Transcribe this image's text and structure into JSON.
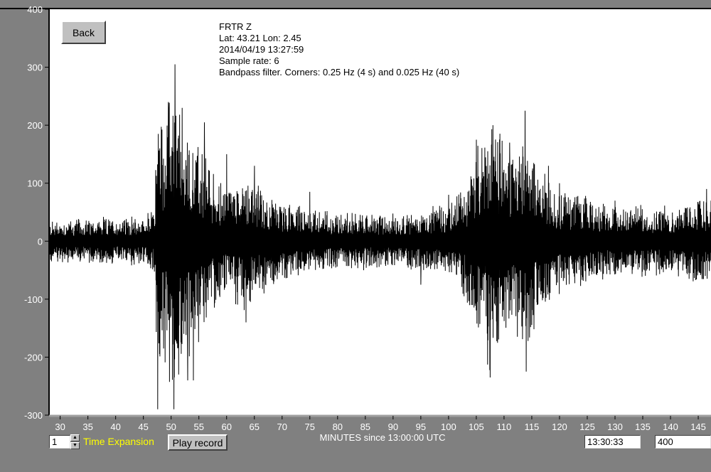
{
  "buttons": {
    "back": "Back",
    "play": "Play record"
  },
  "info": {
    "station": "FRTR  Z",
    "location": "Lat: 43.21 Lon: 2.45",
    "datetime": "2014/04/19 13:27:59",
    "sample_rate": "Sample rate: 6",
    "filter": "Bandpass filter. Corners: 0.25 Hz (4 s) and 0.025 Hz (40 s)"
  },
  "controls": {
    "expansion_value": "1",
    "expansion_label": "Time Expansion",
    "time_value": "13:30:33",
    "zoom_value": "400"
  },
  "chart_data": {
    "type": "line",
    "xlabel": "MINUTES since 13:00:00 UTC",
    "ylabel": "",
    "xlim": [
      28,
      147.3
    ],
    "ylim": [
      -300,
      400
    ],
    "x_ticks": [
      30,
      35,
      40,
      45,
      50,
      55,
      60,
      65,
      70,
      75,
      80,
      85,
      90,
      95,
      100,
      105,
      110,
      115,
      120,
      125,
      130,
      135,
      140,
      145
    ],
    "y_ticks": [
      -300,
      -200,
      -100,
      0,
      100,
      200,
      300,
      400
    ],
    "y_tick_labels": [
      "-300",
      "-200",
      "-100",
      "0",
      "100",
      "200",
      "300",
      "400"
    ],
    "background": "#ffffff",
    "trace_color": "#000000",
    "grid": false,
    "series": [
      {
        "description_points": [
          [
            28,
            0
          ],
          [
            46.5,
            0
          ],
          [
            47.6,
            -290
          ],
          [
            47.7,
            185
          ],
          [
            49.5,
            240
          ],
          [
            50.5,
            -290
          ],
          [
            50.7,
            305
          ],
          [
            52,
            230
          ],
          [
            53,
            -240
          ],
          [
            54,
            -240
          ],
          [
            56,
            205
          ],
          [
            60,
            150
          ],
          [
            63.5,
            -140
          ],
          [
            65,
            130
          ],
          [
            75,
            85
          ],
          [
            95,
            -75
          ],
          [
            100,
            80
          ],
          [
            105,
            175
          ],
          [
            107.5,
            -235
          ],
          [
            108,
            200
          ],
          [
            111,
            170
          ],
          [
            113.8,
            225
          ],
          [
            114,
            -225
          ],
          [
            116,
            -110
          ],
          [
            118,
            130
          ],
          [
            120,
            100
          ],
          [
            130,
            70
          ],
          [
            146.5,
            90
          ],
          [
            147.3,
            70
          ]
        ],
        "values_peak_envelope": [
          [
            28,
            40
          ],
          [
            45,
            45
          ],
          [
            47,
            60
          ],
          [
            47.6,
            290
          ],
          [
            48.5,
            220
          ],
          [
            50.5,
            300
          ],
          [
            52,
            230
          ],
          [
            54,
            200
          ],
          [
            56,
            170
          ],
          [
            58,
            120
          ],
          [
            60,
            100
          ],
          [
            63,
            130
          ],
          [
            66,
            100
          ],
          [
            70,
            70
          ],
          [
            80,
            55
          ],
          [
            90,
            50
          ],
          [
            95,
            55
          ],
          [
            100,
            70
          ],
          [
            103,
            110
          ],
          [
            105,
            170
          ],
          [
            107.5,
            235
          ],
          [
            110,
            190
          ],
          [
            112,
            170
          ],
          [
            113.8,
            225
          ],
          [
            116,
            140
          ],
          [
            118,
            120
          ],
          [
            120,
            100
          ],
          [
            125,
            80
          ],
          [
            130,
            70
          ],
          [
            140,
            65
          ],
          [
            146,
            85
          ],
          [
            147.3,
            70
          ]
        ]
      }
    ]
  }
}
